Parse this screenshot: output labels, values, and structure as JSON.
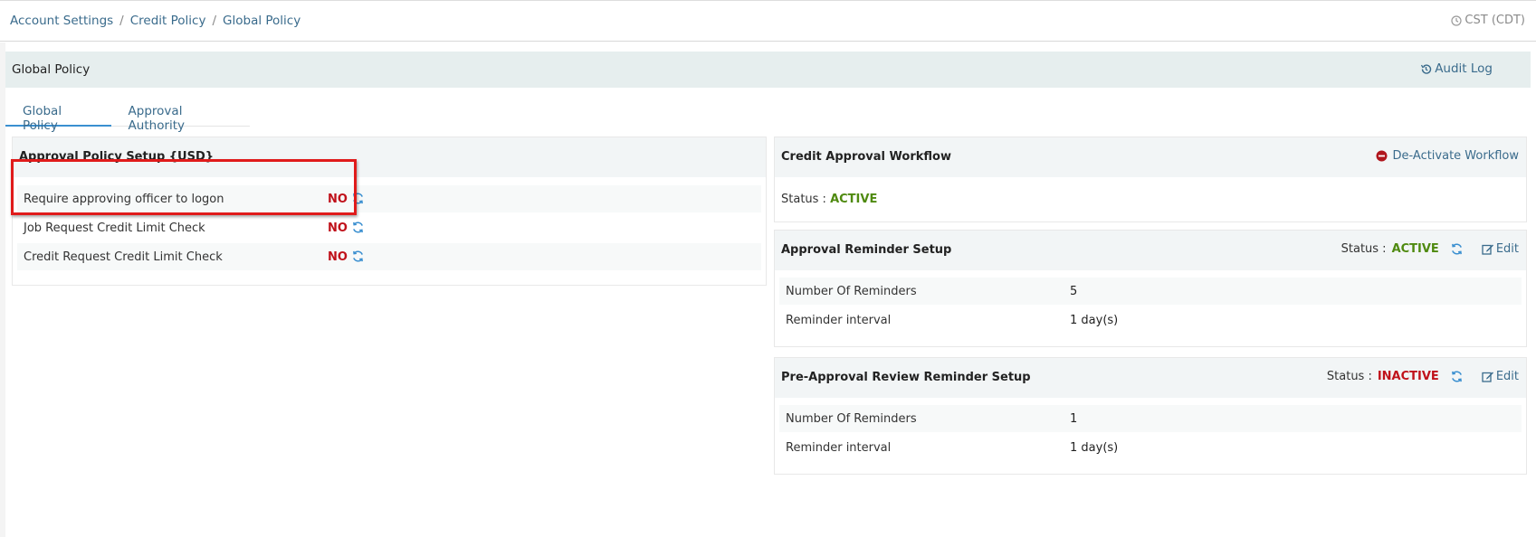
{
  "breadcrumb": [
    "Account Settings",
    "Credit Policy",
    "Global Policy"
  ],
  "timezone": "CST (CDT)",
  "page_title": "Global Policy",
  "audit_log_label": "Audit Log",
  "tabs": [
    {
      "label": "Global Policy",
      "active": true
    },
    {
      "label": "Approval Authority",
      "active": false
    }
  ],
  "approval_policy": {
    "title": "Approval Policy Setup {USD}",
    "rows": [
      {
        "label": "Require approving officer to logon",
        "value": "NO"
      },
      {
        "label": "Job Request Credit Limit Check",
        "value": "NO"
      },
      {
        "label": "Credit Request Credit Limit Check",
        "value": "NO"
      }
    ]
  },
  "workflow": {
    "title": "Credit Approval Workflow",
    "deactivate_label": "De-Activate Workflow",
    "status_label": "Status :",
    "status_value": "ACTIVE"
  },
  "approval_reminder": {
    "title": "Approval Reminder Setup",
    "status_label": "Status :",
    "status_value": "ACTIVE",
    "edit_label": "Edit",
    "rows": [
      {
        "label": "Number Of Reminders",
        "value": "5"
      },
      {
        "label": "Reminder interval",
        "value": "1 day(s)"
      }
    ]
  },
  "pre_approval_reminder": {
    "title": "Pre-Approval Review Reminder Setup",
    "status_label": "Status :",
    "status_value": "INACTIVE",
    "edit_label": "Edit",
    "rows": [
      {
        "label": "Number Of Reminders",
        "value": "1"
      },
      {
        "label": "Reminder interval",
        "value": "1 day(s)"
      }
    ]
  },
  "colors": {
    "link": "#3a6b8c",
    "active": "#4f8a10",
    "inactive": "#c0121b",
    "highlight": "#e01b1b",
    "header_bg": "#e6eeee"
  },
  "icons": [
    "clock-icon",
    "history-icon",
    "refresh-icon",
    "minus-circle-icon",
    "edit-icon"
  ]
}
